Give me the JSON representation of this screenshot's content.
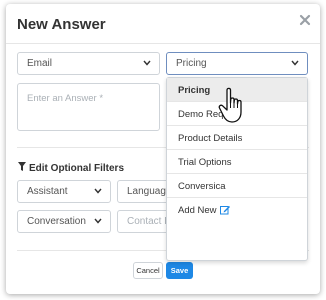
{
  "dialog": {
    "title": "New Answer",
    "close_icon": "close-icon"
  },
  "form": {
    "channel_select": "Email",
    "category_select": "Pricing",
    "answer_placeholder": "Enter an Answer *"
  },
  "category_dropdown": {
    "options": [
      "Pricing",
      "Demo Reque",
      "Product Details",
      "Trial Options",
      "Conversica"
    ],
    "selected": "Pricing",
    "add_new_label": "Add New",
    "add_new_icon": "edit-icon"
  },
  "filters": {
    "title": "Edit Optional Filters",
    "icon": "filter-icon",
    "assistant_select": "Assistant",
    "language_select": "Language",
    "conversation_select": "Conversation",
    "contact_list_placeholder": "Contact Lis"
  },
  "footer": {
    "cancel_label": "Cancel",
    "save_label": "Save"
  },
  "colors": {
    "primary": "#1e88e5",
    "selected_option_bg": "#ececec",
    "border": "#cfd4d9",
    "edit_icon": "#1e88e5"
  },
  "cursor": "hand-pointer"
}
